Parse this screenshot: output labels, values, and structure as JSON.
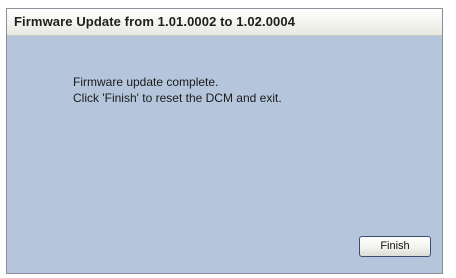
{
  "window": {
    "title": "Firmware Update from 1.01.0002 to 1.02.0004"
  },
  "message": {
    "line1": "Firmware update complete.",
    "line2": "Click 'Finish' to reset the DCM and exit."
  },
  "buttons": {
    "finish_label": "Finish"
  },
  "colors": {
    "background": "#b5c6dc",
    "titlebar": "#f4f4ef",
    "text": "#1a1a1a"
  }
}
